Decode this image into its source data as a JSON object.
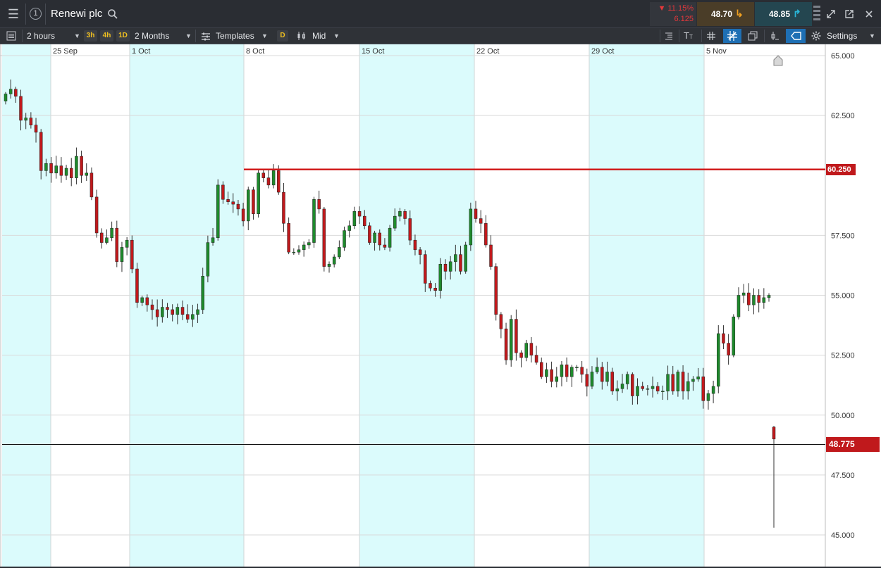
{
  "header": {
    "instrument": "Renewi plc",
    "counter": "1",
    "change_percent": "▼ 11.15%",
    "change_value": "6.125",
    "sell_price": "48.70",
    "buy_price": "48.85"
  },
  "toolbar": {
    "interval": "2 hours",
    "tf_3h": "3h",
    "tf_4h": "4h",
    "tf_1d": "1D",
    "range": "2 Months",
    "templates": "Templates",
    "d_button": "D",
    "price_type": "Mid",
    "settings": "Settings"
  },
  "colors": {
    "up": "#1e8a2c",
    "down": "#c0191c",
    "shade": "#dbfbfc",
    "resistance": "#d11d1d"
  },
  "chart_data": {
    "type": "candlestick",
    "x_labels": [
      "25 Sep",
      "1 Oct",
      "8 Oct",
      "15 Oct",
      "22 Oct",
      "29 Oct",
      "5 Nov"
    ],
    "y_ticks": [
      "65.000",
      "62.500",
      "60.250",
      "57.500",
      "55.000",
      "52.500",
      "50.000",
      "48.775",
      "47.500",
      "45.000"
    ],
    "y_range": [
      45.0,
      65.0
    ],
    "horizontal_line": 60.25,
    "current_price": 48.775,
    "last_candle": {
      "open": 49.5,
      "high": 49.55,
      "low": 45.3,
      "close": 49.0
    },
    "closes": [
      63.4,
      63.6,
      63.3,
      62.3,
      62.4,
      62.1,
      61.8,
      60.2,
      60.5,
      60.1,
      60.4,
      60.0,
      60.3,
      59.9,
      60.8,
      60.0,
      60.1,
      59.1,
      57.6,
      57.2,
      57.4,
      57.8,
      56.4,
      57.0,
      57.3,
      56.1,
      54.7,
      54.9,
      54.6,
      54.4,
      54.1,
      54.5,
      54.4,
      54.2,
      54.5,
      54.2,
      54.0,
      54.2,
      54.4,
      55.8,
      57.2,
      57.4,
      59.6,
      59.0,
      58.9,
      58.8,
      58.6,
      58.1,
      59.4,
      58.4,
      60.1,
      59.9,
      59.6,
      60.2,
      59.3,
      58.0,
      56.8,
      56.8,
      56.9,
      57.1,
      57.2,
      59.0,
      58.6,
      56.2,
      56.3,
      56.6,
      57.0,
      57.7,
      57.9,
      58.5,
      58.3,
      57.9,
      57.2,
      57.6,
      57.1,
      57.0,
      57.8,
      58.3,
      58.5,
      58.2,
      57.3,
      56.9,
      56.7,
      55.5,
      55.3,
      55.2,
      56.3,
      56.0,
      56.4,
      56.7,
      56.0,
      57.1,
      58.6,
      58.2,
      58.0,
      57.1,
      56.2,
      54.2,
      53.6,
      52.3,
      54.0,
      52.6,
      52.4,
      53.0,
      52.5,
      52.2,
      51.6,
      51.9,
      51.4,
      51.6,
      52.1,
      51.6,
      52.0,
      52.0,
      51.7,
      51.2,
      51.8,
      52.0,
      51.4,
      51.8,
      51.0,
      51.1,
      51.3,
      51.7,
      50.8,
      51.2,
      51.1,
      51.1,
      51.2,
      51.0,
      51.0,
      51.7,
      51.0,
      51.8,
      51.0,
      51.4,
      51.5,
      51.6,
      50.6,
      50.9,
      51.2,
      53.4,
      53.0,
      52.5,
      54.1,
      55.0,
      55.1,
      54.6,
      55.0,
      54.7,
      54.9,
      55.0
    ]
  }
}
